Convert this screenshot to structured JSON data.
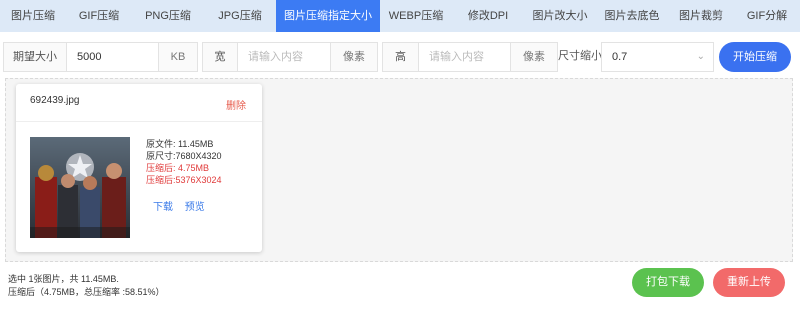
{
  "tabs": [
    {
      "label": "图片压缩"
    },
    {
      "label": "GIF压缩"
    },
    {
      "label": "PNG压缩"
    },
    {
      "label": "JPG压缩"
    },
    {
      "label": "图片压缩指定大小"
    },
    {
      "label": "WEBP压缩"
    },
    {
      "label": "修改DPI"
    },
    {
      "label": "图片改大小"
    },
    {
      "label": "图片去底色"
    },
    {
      "label": "图片裁剪"
    },
    {
      "label": "GIF分解"
    }
  ],
  "options": {
    "expected_label": "期望大小",
    "expected_value": "5000",
    "expected_unit": "KB",
    "width_label": "宽",
    "width_placeholder": "请输入内容",
    "width_unit": "像素",
    "height_label": "高",
    "height_placeholder": "请输入内容",
    "height_unit": "像素",
    "scale_label": "尺寸缩小",
    "scale_value": "0.7",
    "start_label": "开始压缩"
  },
  "file": {
    "name": "692439.jpg",
    "delete_label": "删除",
    "original_size": "原文件: 11.45MB",
    "original_dims": "原尺寸:7680X4320",
    "compressed_size": "压缩后: 4.75MB",
    "compressed_dims": "压缩后:5376X3024",
    "download_label": "下载",
    "preview_label": "预览"
  },
  "summary": {
    "line1": "选中 1张图片，共 11.45MB.",
    "line2": "压缩后（4.75MB，总压缩率 :58.51%）"
  },
  "buttons": {
    "download_all": "打包下载",
    "reupload": "重新上传"
  },
  "colors": {
    "accent": "#3c7bf3",
    "green": "#5bc24f",
    "red": "#f26a6a",
    "compressed_text": "#e03a3a"
  }
}
